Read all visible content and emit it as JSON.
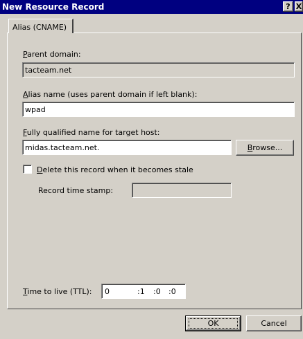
{
  "window": {
    "title": "New Resource Record",
    "help_glyph": "?",
    "close_glyph": "X"
  },
  "tab": {
    "label": "Alias (CNAME)"
  },
  "parent_domain": {
    "label_accel": "P",
    "label_rest": "arent domain:",
    "value": "tacteam.net"
  },
  "alias_name": {
    "label_accel": "A",
    "label_rest": "lias name (uses parent domain if left blank):",
    "value": "wpad"
  },
  "target_host": {
    "label_accel": "F",
    "label_rest": "ully qualified name for target host:",
    "value": "midas.tacteam.net.",
    "browse_accel": "B",
    "browse_rest": "rowse..."
  },
  "stale": {
    "label_accel": "D",
    "label_rest": "elete this record when it becomes stale",
    "checked": false
  },
  "timestamp": {
    "label": "Record time stamp:",
    "value": ""
  },
  "ttl": {
    "label_accel": "T",
    "label_rest": "ime to live (TTL):",
    "days": "0",
    "hours": ":1",
    "minutes": ":0",
    "seconds": ":0"
  },
  "buttons": {
    "ok": "OK",
    "cancel": "Cancel"
  }
}
